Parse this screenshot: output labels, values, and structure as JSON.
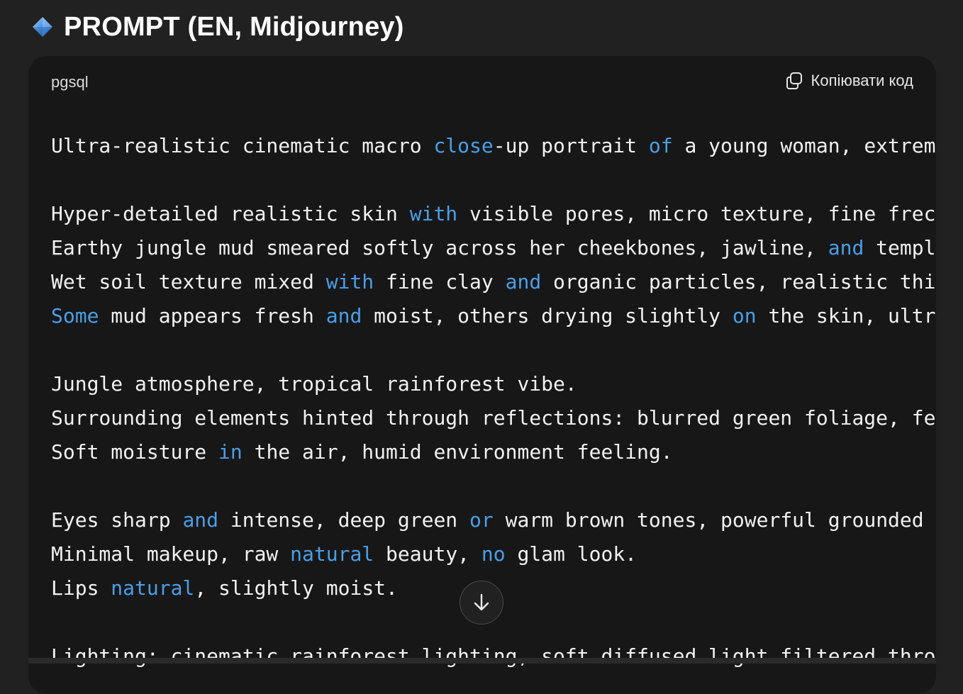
{
  "heading": {
    "title": "PROMPT (EN, Midjourney)",
    "icon": "blue-diamond-icon",
    "icon_color": "#4a90e2"
  },
  "code_block": {
    "language": "pgsql",
    "copy_label": "Копіювати код",
    "keyword_color": "#4a9fe8",
    "text_color": "#f2f2f2",
    "background": "#171717",
    "lines": [
      [
        [
          "Ultra-realistic cinematic macro ",
          false
        ],
        [
          "close",
          true
        ],
        [
          "-up portrait ",
          false
        ],
        [
          "of",
          true
        ],
        [
          " a young woman, extrem",
          false
        ]
      ],
      [],
      [
        [
          "Hyper-detailed realistic skin ",
          false
        ],
        [
          "with",
          true
        ],
        [
          " visible pores, micro texture, fine frec",
          false
        ]
      ],
      [
        [
          "Earthy jungle mud smeared softly across her cheekbones, jawline, ",
          false
        ],
        [
          "and",
          true
        ],
        [
          " templ",
          false
        ]
      ],
      [
        [
          "Wet soil texture mixed ",
          false
        ],
        [
          "with",
          true
        ],
        [
          " fine clay ",
          false
        ],
        [
          "and",
          true
        ],
        [
          " organic particles, realistic thi",
          false
        ]
      ],
      [
        [
          "Some",
          true
        ],
        [
          " mud appears fresh ",
          false
        ],
        [
          "and",
          true
        ],
        [
          " moist, others drying slightly ",
          false
        ],
        [
          "on",
          true
        ],
        [
          " the skin, ultr",
          false
        ]
      ],
      [],
      [
        [
          "Jungle atmosphere, tropical rainforest vibe.",
          false
        ]
      ],
      [
        [
          "Surrounding elements hinted through reflections: blurred green foliage, fe",
          false
        ]
      ],
      [
        [
          "Soft moisture ",
          false
        ],
        [
          "in",
          true
        ],
        [
          " the air, humid environment feeling.",
          false
        ]
      ],
      [],
      [
        [
          "Eyes sharp ",
          false
        ],
        [
          "and",
          true
        ],
        [
          " intense, deep green ",
          false
        ],
        [
          "or",
          true
        ],
        [
          " warm brown tones, powerful grounded",
          false
        ]
      ],
      [
        [
          "Minimal makeup, raw ",
          false
        ],
        [
          "natural",
          true
        ],
        [
          " beauty, ",
          false
        ],
        [
          "no",
          true
        ],
        [
          " glam look.",
          false
        ]
      ],
      [
        [
          "Lips ",
          false
        ],
        [
          "natural",
          true
        ],
        [
          ", slightly moist.",
          false
        ]
      ],
      [],
      [
        [
          "Lighting: cinematic rainforest lighting, soft diffused light filtered thro",
          false
        ]
      ]
    ]
  },
  "scroll_button": {
    "icon": "arrow-down-icon"
  }
}
